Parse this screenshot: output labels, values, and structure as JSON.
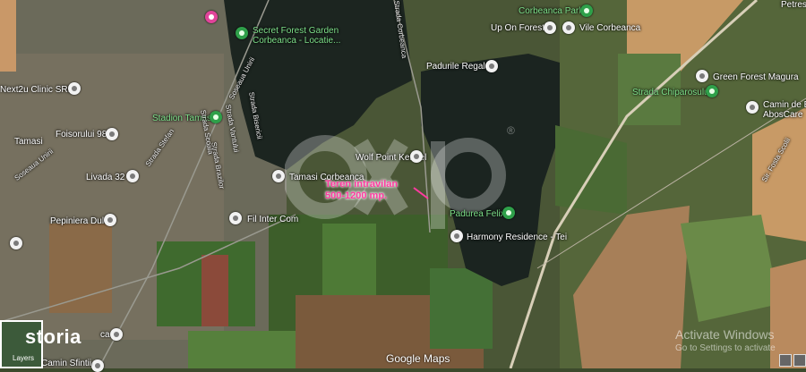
{
  "map": {
    "listing_label_line1": "Teren intravilan",
    "listing_label_line2": "500-1200 mp.",
    "watermark_logo": "CXP",
    "watermark_registered": "®",
    "attribution": "Google Maps",
    "brand": "storia",
    "layers_label": "Layers",
    "activate_title": "Activate Windows",
    "activate_sub": "Go to Settings to activate",
    "places": [
      {
        "name": "Secret Forest Garden",
        "name2": "Corbeanca - Locatie..."
      },
      {
        "name": "Corbeanca Park"
      },
      {
        "name": "Up On Forest"
      },
      {
        "name": "Vile Corbeanca"
      },
      {
        "name": "Padurile Regale"
      },
      {
        "name": "Next2u Clinic SRL"
      },
      {
        "name": "Foisorului 98"
      },
      {
        "name": "Tamasi"
      },
      {
        "name": "Stadion Tamasi"
      },
      {
        "name": "Livada 32"
      },
      {
        "name": "Tamasi Corbeanca"
      },
      {
        "name": "Wolf Point Kennel"
      },
      {
        "name": "Pepiniera Dulce"
      },
      {
        "name": "Fil Inter Com"
      },
      {
        "name": "Padurea Felix"
      },
      {
        "name": "Harmony Residence - Tei"
      },
      {
        "name": "Green Forest Magura"
      },
      {
        "name": "Camin de Batrani",
        "name2": "AbosCare"
      },
      {
        "name": "Strada Chiparosului"
      },
      {
        "name": "Petres"
      },
      {
        "name": "Camin Sfintii"
      },
      {
        "name": "ca"
      }
    ],
    "roads": [
      "Strada Corbeanca",
      "Soseaua Unirii",
      "Strada Bisericii",
      "Strada Vantului",
      "Strada Stefan",
      "Strada Brazilor",
      "Soseaua Unirii",
      "Strada Scoala",
      "Sir. Fosta Scolii"
    ]
  }
}
